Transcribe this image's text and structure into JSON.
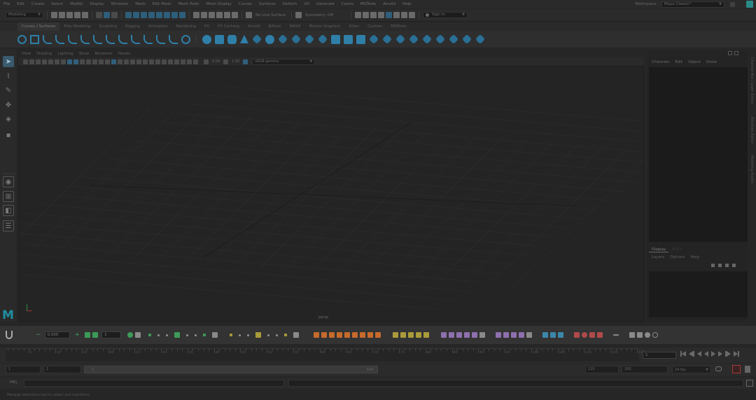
{
  "menubar": {
    "items": [
      "File",
      "Edit",
      "Create",
      "Select",
      "Modify",
      "Display",
      "Windows",
      "Mesh",
      "Edit Mesh",
      "Mesh Tools",
      "Mesh Display",
      "Curves",
      "Surfaces",
      "Deform",
      "UV",
      "Generate",
      "Cache",
      "MGTools",
      "Arnold",
      "Help"
    ],
    "workspace_label": "Workspace :",
    "workspace_value": "Maya Classic*"
  },
  "statusline": {
    "mode": "Modeling",
    "live_surface": "No Live Surface",
    "symmetry": "Symmetry: Off",
    "sign_in": "Sign In"
  },
  "shelf": {
    "tabs": [
      "Curves / Surfaces",
      "Poly Modeling",
      "Sculpting",
      "Rigging",
      "Animation",
      "Rendering",
      "FX",
      "FX Caching",
      "Arnold",
      "Bifrost",
      "MASH",
      "Motion Graphics",
      "XGen",
      "Custom",
      "MGTools"
    ],
    "active_tab": 0
  },
  "viewport": {
    "menu": [
      "View",
      "Shading",
      "Lighting",
      "Show",
      "Renderer",
      "Panels"
    ],
    "exposure": "0.00",
    "gamma": "1.00",
    "color_space": "sRGB gamma",
    "camera": "persp"
  },
  "channelbox": {
    "menu": [
      "Channels",
      "Edit",
      "Object",
      "Show"
    ],
    "layer_tabs": [
      "Display",
      "Anim"
    ],
    "layer_menu": [
      "Layers",
      "Options",
      "Help"
    ],
    "side_tabs": [
      "Channel Box / Layer Editor",
      "Attribute Editor",
      "Modeling Toolkit"
    ]
  },
  "bottomshelf": {
    "value": "0.500",
    "count": "1"
  },
  "timeslider": {
    "ticks": [
      "5",
      "10",
      "15",
      "20",
      "25",
      "30",
      "35",
      "40",
      "45",
      "50",
      "55",
      "60",
      "65",
      "70",
      "75",
      "80",
      "85",
      "90",
      "95",
      "100",
      "105",
      "110",
      "115",
      "120"
    ],
    "current_frame": "1"
  },
  "rangeslider": {
    "start": "1",
    "anim_start": "1",
    "range_start_label": "1",
    "range_end_label": "120",
    "range_end": "120",
    "anim_end": "200",
    "fps": "24 fps"
  },
  "cmdline": {
    "lang": "MEL",
    "help": "Manage selections tool to select and transform"
  }
}
